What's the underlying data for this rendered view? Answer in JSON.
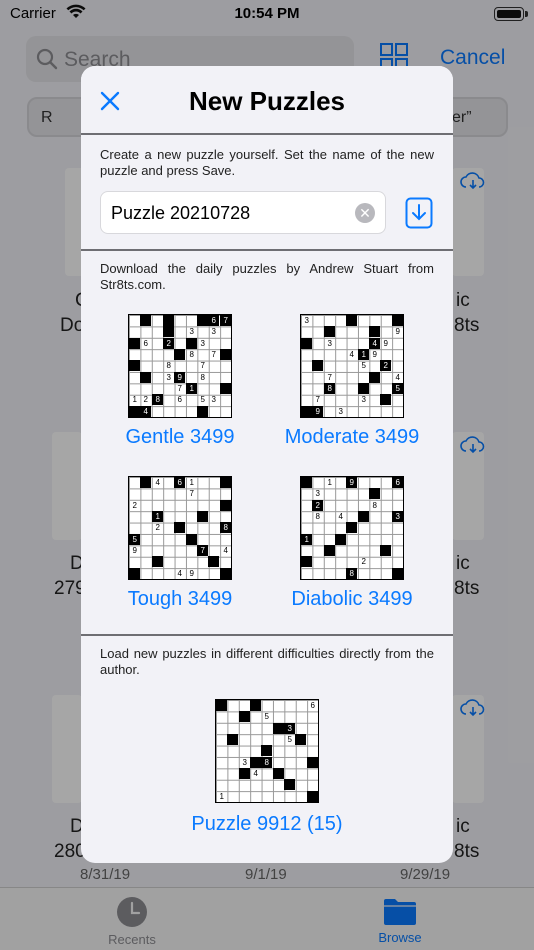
{
  "status_bar": {
    "carrier": "Carrier",
    "time": "10:54 PM"
  },
  "background": {
    "search_placeholder": "Search",
    "cancel_label": "Cancel",
    "chip_left": "R",
    "chip_right": "ver”",
    "row1": {
      "left_lines": [
        "C",
        "Do"
      ],
      "right_lines": [
        "ic",
        "8ts"
      ]
    },
    "row2": {
      "left_lines": [
        "D",
        "279"
      ],
      "right_lines": [
        "ic",
        "8ts"
      ]
    },
    "row3": {
      "left_lines": [
        "D",
        "280"
      ],
      "right_lines": [
        "ic",
        "8ts"
      ]
    },
    "dates": [
      "8/31/19",
      "9/1/19",
      "9/29/19"
    ],
    "tabs": {
      "recents": "Recents",
      "browse": "Browse"
    }
  },
  "modal": {
    "title": "New Puzzles",
    "create_text": "Create a new puzzle yourself. Set the name of the new puzzle and press Save.",
    "name_value": "Puzzle 20210728",
    "download_text": "Download the daily puzzles by Andrew Stuart from Str8ts.com.",
    "daily": [
      {
        "label": "Gentle 3499"
      },
      {
        "label": "Moderate 3499"
      },
      {
        "label": "Tough 3499"
      },
      {
        "label": "Diabolic 3499"
      }
    ],
    "load_text": "Load new puzzles in different difficulties directly from the author.",
    "author_puzzle": {
      "label": "Puzzle 9912 (15)"
    }
  },
  "colors": {
    "accent": "#0a7aff",
    "background": "#f2f2f7"
  }
}
